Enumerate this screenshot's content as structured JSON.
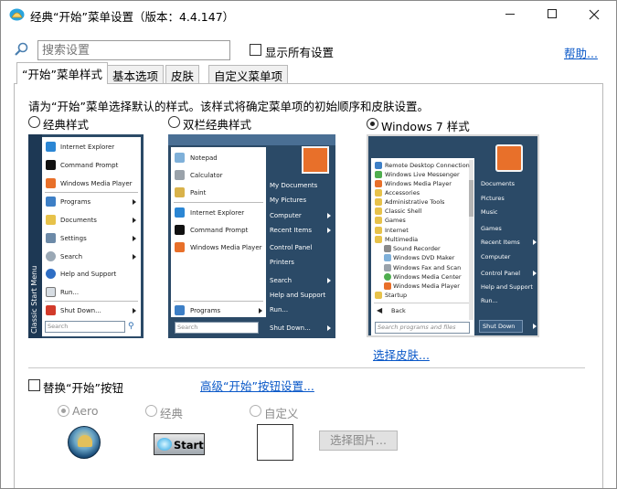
{
  "window": {
    "title": "经典“开始”菜单设置（版本：4.4.147）",
    "controls": {
      "minimize": "—",
      "maximize": "☐",
      "close": "✕"
    }
  },
  "toolbar": {
    "search_placeholder": "搜索设置",
    "show_all_label": "显示所有设置",
    "help_label": "帮助..."
  },
  "tabs": [
    "“开始”菜单样式",
    "基本选项",
    "皮肤",
    "自定义菜单项"
  ],
  "main": {
    "description": "请为“开始”菜单选择默认的样式。该样式将确定菜单项的初始顺序和皮肤设置。",
    "styles": [
      {
        "label": "经典样式",
        "selected": false
      },
      {
        "label": "双栏经典样式",
        "selected": false
      },
      {
        "label": "Windows 7 样式",
        "selected": true
      }
    ],
    "select_skin_link": "选择皮肤...",
    "replace_button_label": "替换“开始”按钮",
    "advanced_link": "高级“开始”按钮设置...",
    "button_options": [
      {
        "label": "Aero",
        "selected": true
      },
      {
        "label": "经典",
        "selected": false
      },
      {
        "label": "自定义",
        "selected": false
      }
    ],
    "start_button_text": "Start",
    "choose_image_label": "选择图片..."
  },
  "preview_classic": {
    "side_label": "Classic Start Menu",
    "items": [
      "Internet Explorer",
      "Command Prompt",
      "Windows Media Player",
      "Programs",
      "Documents",
      "Settings",
      "Search",
      "Help and Support",
      "Run...",
      "Shut Down..."
    ],
    "search": "Search"
  },
  "preview_two_column": {
    "left_items": [
      "Notepad",
      "Calculator",
      "Paint",
      "Internet Explorer",
      "Command Prompt",
      "Windows Media Player"
    ],
    "programs": "Programs",
    "search": "Search",
    "right_items": [
      "My Documents",
      "My Pictures",
      "Computer",
      "Recent Items",
      "Control Panel",
      "Printers",
      "Search",
      "Help and Support",
      "Run...",
      "Shut Down..."
    ]
  },
  "preview_win7": {
    "left_items": [
      "Remote Desktop Connection",
      "Windows Live Messenger",
      "Windows Media Player",
      "Accessories",
      "Administrative Tools",
      "Classic Shell",
      "Games",
      "Internet",
      "Multimedia",
      "Sound Recorder",
      "Windows DVD Maker",
      "Windows Fax and Scan",
      "Windows Media Center",
      "Windows Media Player",
      "Startup"
    ],
    "back": "Back",
    "search": "Search programs and files",
    "right_items": [
      "Documents",
      "Pictures",
      "Music",
      "Games",
      "Recent Items",
      "Computer",
      "Control Panel",
      "Help and Support",
      "Run...",
      "Shut Down"
    ]
  },
  "colors": {
    "link": "#0a58c8",
    "menu_dark": "#2b4a67",
    "accent_orange": "#e8702a"
  }
}
